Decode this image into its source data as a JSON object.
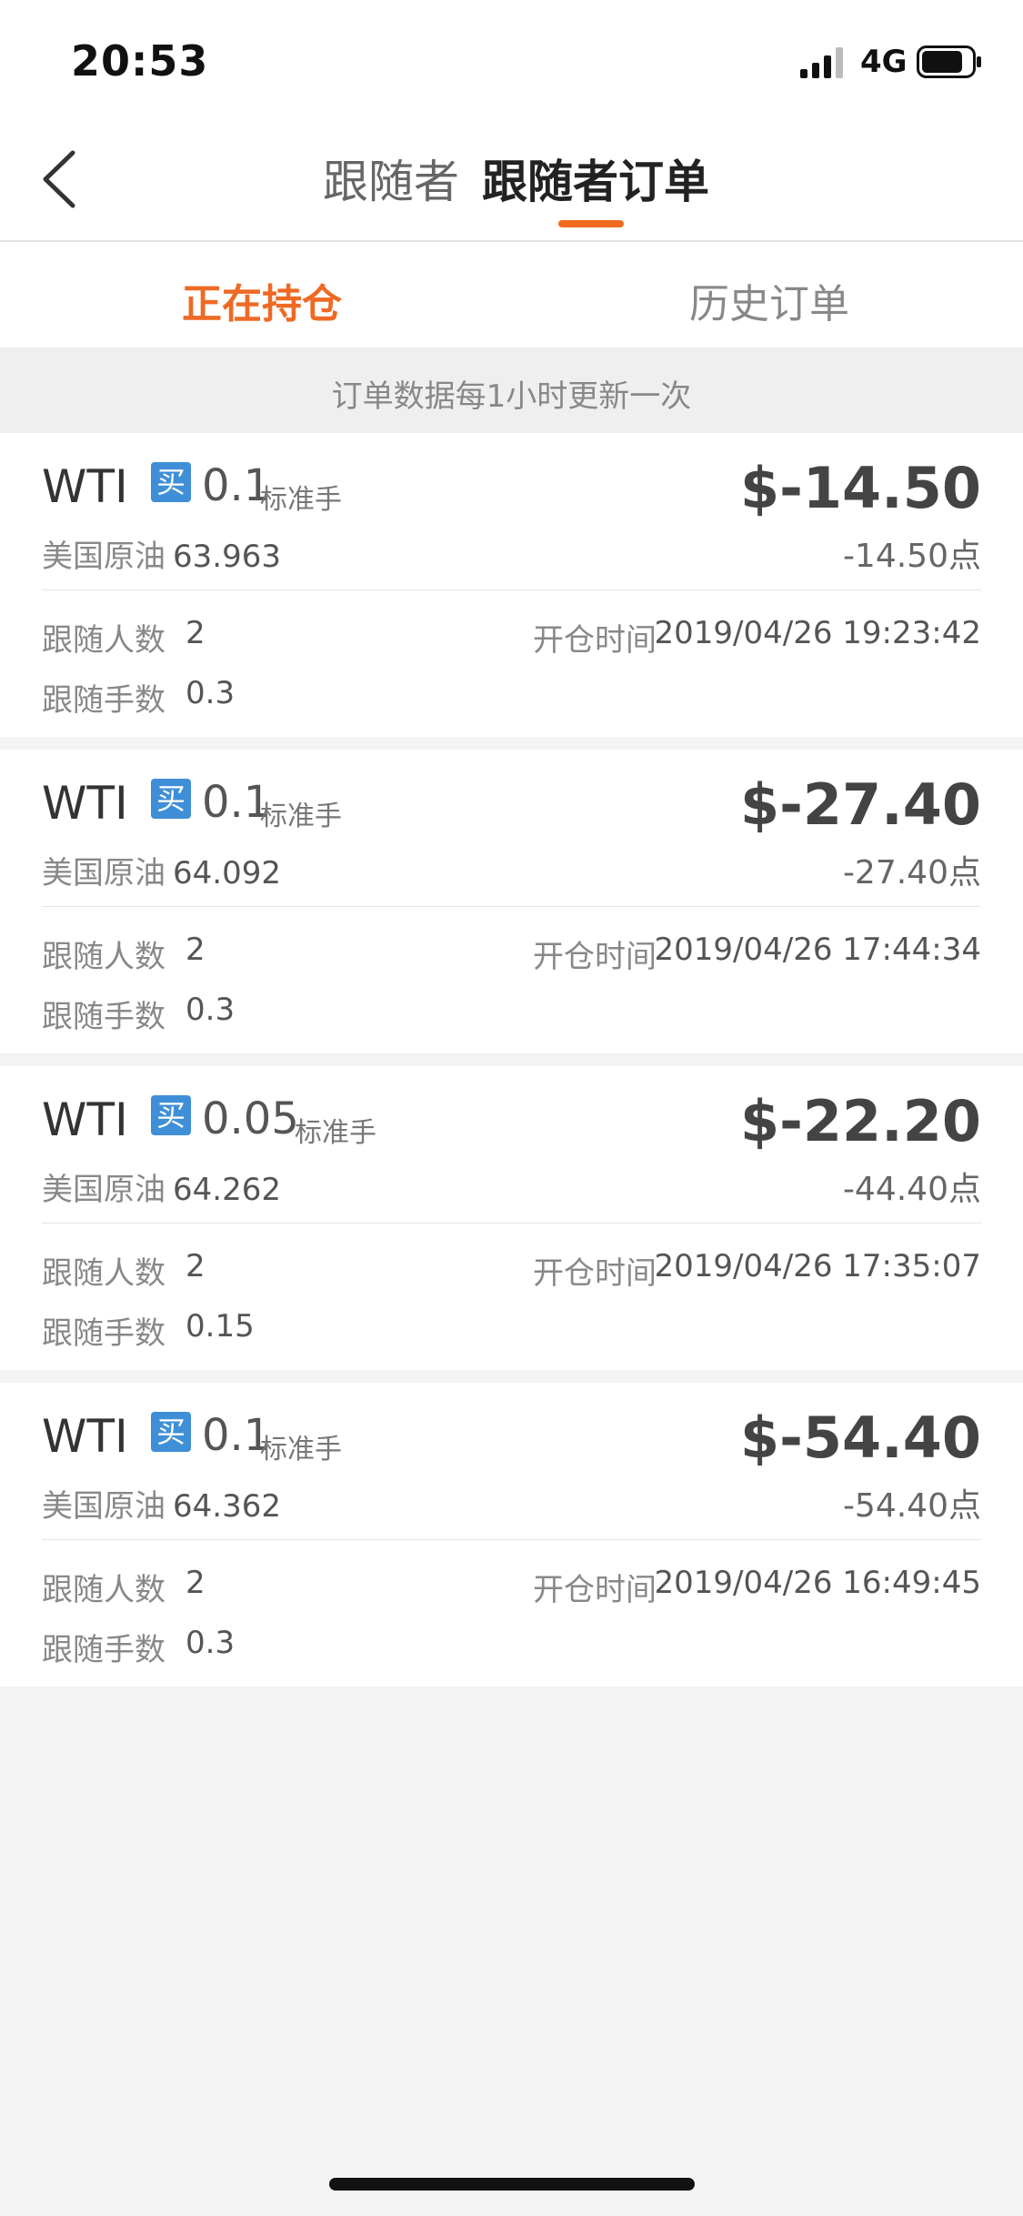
{
  "status_bar": {
    "time": "20:53",
    "network": "4G",
    "icons": [
      "signal-icon",
      "battery-icon"
    ]
  },
  "nav": {
    "back_icon": "chevron-left-icon",
    "tabs": [
      {
        "label": "跟随者",
        "active": false
      },
      {
        "label": "跟随者订单",
        "active": true
      }
    ],
    "accent_color": "#f06a1e"
  },
  "sub_tabs": [
    {
      "label": "正在持仓",
      "active": true
    },
    {
      "label": "历史订单",
      "active": false
    }
  ],
  "notice": "订单数据每1小时更新一次",
  "labels": {
    "buy_badge": "买",
    "lots_unit": "标准手",
    "followers_count": "跟随人数",
    "open_time": "开仓时间",
    "follow_lots": "跟随手数"
  },
  "orders": [
    {
      "symbol": "WTI",
      "lots": "0.1",
      "amount": "$-14.50",
      "instrument": "美国原油",
      "price": "63.963",
      "points": "-14.50点",
      "followers": "2",
      "open_time": "2019/04/26 19:23:42",
      "follow_lots": "0.3"
    },
    {
      "symbol": "WTI",
      "lots": "0.1",
      "amount": "$-27.40",
      "instrument": "美国原油",
      "price": "64.092",
      "points": "-27.40点",
      "followers": "2",
      "open_time": "2019/04/26 17:44:34",
      "follow_lots": "0.3"
    },
    {
      "symbol": "WTI",
      "lots": "0.05",
      "amount": "$-22.20",
      "instrument": "美国原油",
      "price": "64.262",
      "points": "-44.40点",
      "followers": "2",
      "open_time": "2019/04/26 17:35:07",
      "follow_lots": "0.15"
    },
    {
      "symbol": "WTI",
      "lots": "0.1",
      "amount": "$-54.40",
      "instrument": "美国原油",
      "price": "64.362",
      "points": "-54.40点",
      "followers": "2",
      "open_time": "2019/04/26 16:49:45",
      "follow_lots": "0.3"
    }
  ]
}
